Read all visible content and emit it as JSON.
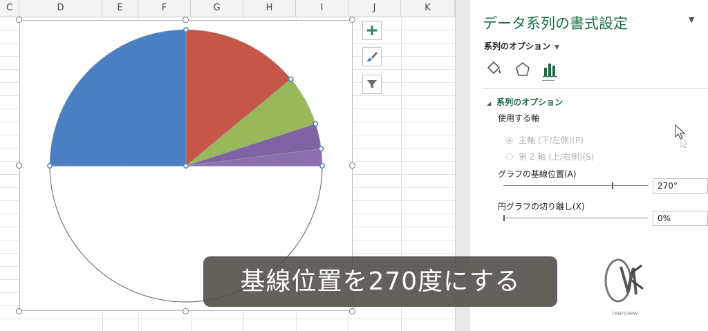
{
  "sheet": {
    "columns": [
      "C",
      "D",
      "E",
      "F",
      "G",
      "H",
      "I",
      "J",
      "K"
    ]
  },
  "chart": {
    "type": "pie",
    "first_slice_angle_deg": 270,
    "slices": [
      {
        "value": 50,
        "color": "#4a7fc1"
      },
      {
        "value": 28,
        "color": "#c65648"
      },
      {
        "value": 12,
        "color": "#99b85a"
      },
      {
        "value": 6,
        "color": "#7e62a3"
      },
      {
        "value": 4,
        "color": "#8c6fb0"
      }
    ],
    "hidden_half_color": "#ffffff"
  },
  "chart_buttons": [
    {
      "icon": "plus-icon"
    },
    {
      "icon": "brush-icon"
    },
    {
      "icon": "filter-icon"
    }
  ],
  "pane": {
    "title": "データ系列の書式設定",
    "options_dropdown": "系列のオプション",
    "tabs": [
      {
        "icon": "fill-bucket-icon"
      },
      {
        "icon": "pentagon-icon"
      },
      {
        "icon": "bar-chart-icon"
      }
    ],
    "section": "系列のオプション",
    "axis_label": "使用する軸",
    "radio_primary": "主軸 (下/左側)(P)",
    "radio_secondary": "第 2 軸 (上/右側)(S)",
    "baseline_label": "グラフの基線位置(A)",
    "baseline_value": "270°",
    "explosion_label": "円グラフの切り離し(X)",
    "explosion_value": "0%",
    "logo_caption": "ixenoew"
  },
  "caption": "基線位置を270度にする",
  "colors": {
    "accent_green": "#1e6b43",
    "series_blue": "#4a7fc1",
    "series_red": "#c65648",
    "series_green": "#99b85a",
    "series_purple": "#7e62a3"
  }
}
